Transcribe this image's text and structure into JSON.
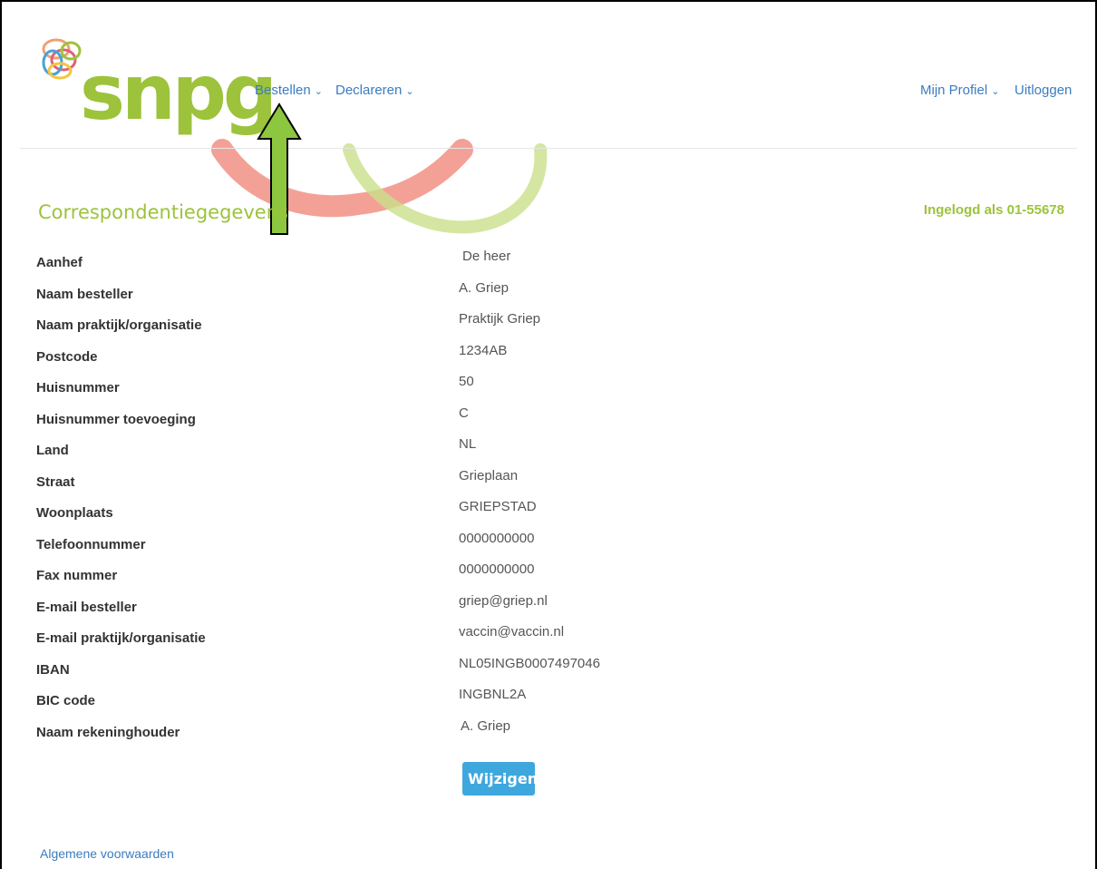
{
  "brand": {
    "logo_text": "snpg",
    "accent": "#9cc33b",
    "link": "#3b7cc0",
    "button": "#3ea8de"
  },
  "nav": {
    "left": [
      {
        "label": "Bestellen",
        "icon": "chevron-down-icon"
      },
      {
        "label": "Declareren",
        "icon": "chevron-down-icon"
      }
    ],
    "right": [
      {
        "label": "Mijn Profiel",
        "icon": "chevron-down-icon"
      },
      {
        "label": "Uitloggen"
      }
    ]
  },
  "page": {
    "title": "Correspondentiegegevens",
    "logged_in": "Ingelogd als 01-55678"
  },
  "fields": [
    {
      "label": "Aanhef",
      "value": "De heer"
    },
    {
      "label": "Naam besteller",
      "value": "A. Griep"
    },
    {
      "label": "Naam praktijk/organisatie",
      "value": "Praktijk Griep"
    },
    {
      "label": "Postcode",
      "value": "1234AB"
    },
    {
      "label": "Huisnummer",
      "value": "50"
    },
    {
      "label": "Huisnummer toevoeging",
      "value": "C"
    },
    {
      "label": "Land",
      "value": "NL"
    },
    {
      "label": "Straat",
      "value": "Grieplaan"
    },
    {
      "label": "Woonplaats",
      "value": "GRIEPSTAD"
    },
    {
      "label": "Telefoonnummer",
      "value": "0000000000"
    },
    {
      "label": "Fax nummer",
      "value": "0000000000"
    },
    {
      "label": "E-mail besteller",
      "value": "griep@griep.nl"
    },
    {
      "label": "E-mail praktijk/organisatie",
      "value": "vaccin@vaccin.nl"
    },
    {
      "label": "IBAN",
      "value": "NL05INGB0007497046"
    },
    {
      "label": "BIC code",
      "value": "INGBNL2A"
    },
    {
      "label": "Naam rekeninghouder",
      "value": "A. Griep"
    }
  ],
  "actions": {
    "edit_label": "Wijzigen"
  },
  "footer": {
    "terms_link": "Algemene voorwaarden"
  }
}
